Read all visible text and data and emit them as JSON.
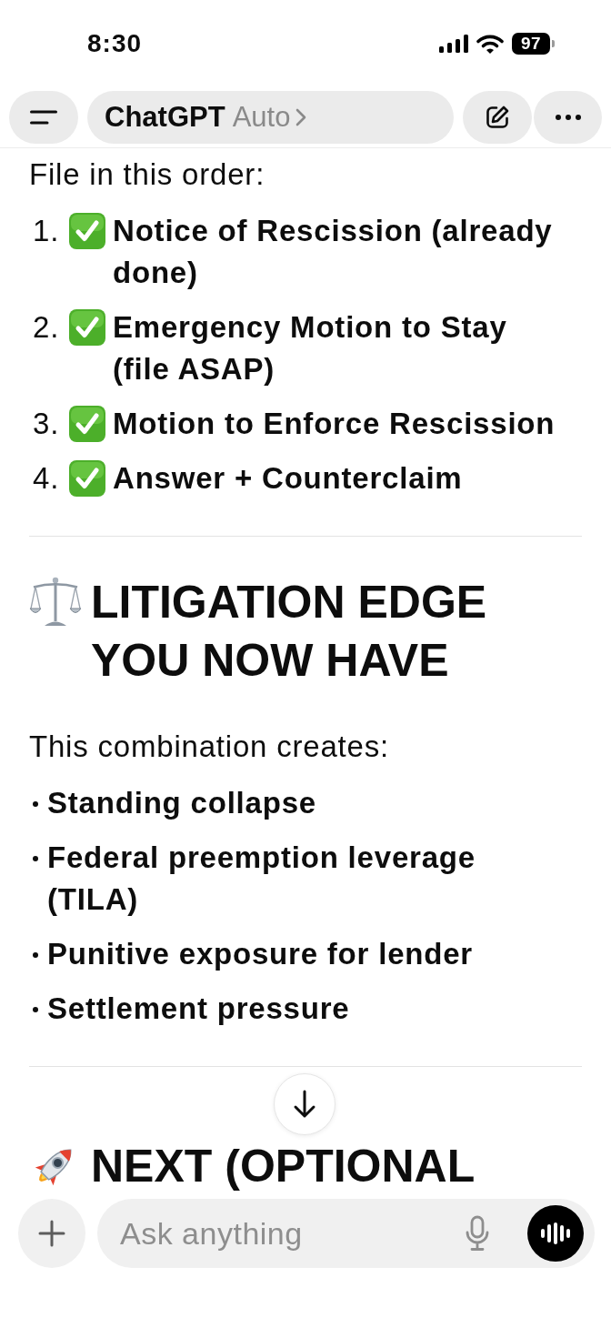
{
  "status_bar": {
    "time": "8:30",
    "battery": "97"
  },
  "header": {
    "title": "ChatGPT",
    "model": "Auto"
  },
  "response": {
    "intro": "File in this order:",
    "steps": [
      {
        "number": "1.",
        "text": "Notice of Rescission (already done)"
      },
      {
        "number": "2.",
        "text": "Emergency Motion to Stay (file ASAP)"
      },
      {
        "number": "3.",
        "text": "Motion to Enforce Rescission"
      },
      {
        "number": "4.",
        "text": "Answer + Counterclaim"
      }
    ],
    "section": {
      "heading": "LITIGATION EDGE YOU NOW HAVE",
      "intro": "This combination creates:",
      "bullets": [
        "Standing collapse",
        "Federal preemption leverage (TILA)",
        "Punitive exposure for lender",
        "Settlement pressure"
      ]
    },
    "next_section": {
      "heading": "NEXT (OPTIONAL"
    }
  },
  "composer": {
    "placeholder": "Ask anything"
  }
}
